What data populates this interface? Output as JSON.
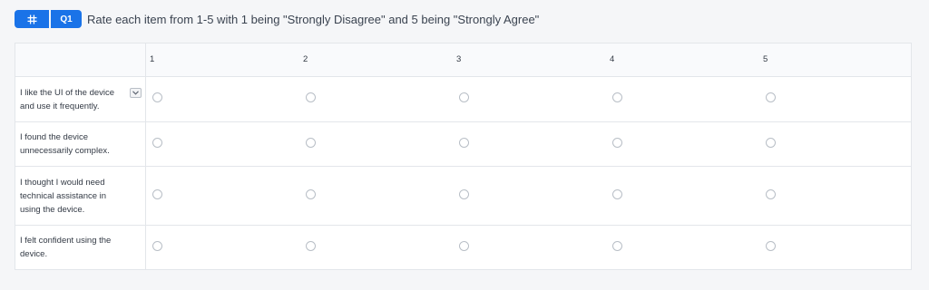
{
  "header": {
    "hash_icon": "hash-icon",
    "question_number": "Q1",
    "question_text": "Rate each item from 1-5 with 1 being \"Strongly Disagree\" and 5 being \"Strongly Agree\""
  },
  "matrix": {
    "scale": [
      "1",
      "2",
      "3",
      "4",
      "5"
    ],
    "statements": [
      "I like the UI of the device and use it frequently.",
      "I found the device unnecessarily complex.",
      "I thought I would need technical assistance in using the device.",
      "I felt confident using the device."
    ],
    "selected": [
      null,
      null,
      null,
      null
    ]
  },
  "colors": {
    "accent": "#1a73e8",
    "background": "#f5f6f8",
    "border": "#e3e6ea"
  }
}
